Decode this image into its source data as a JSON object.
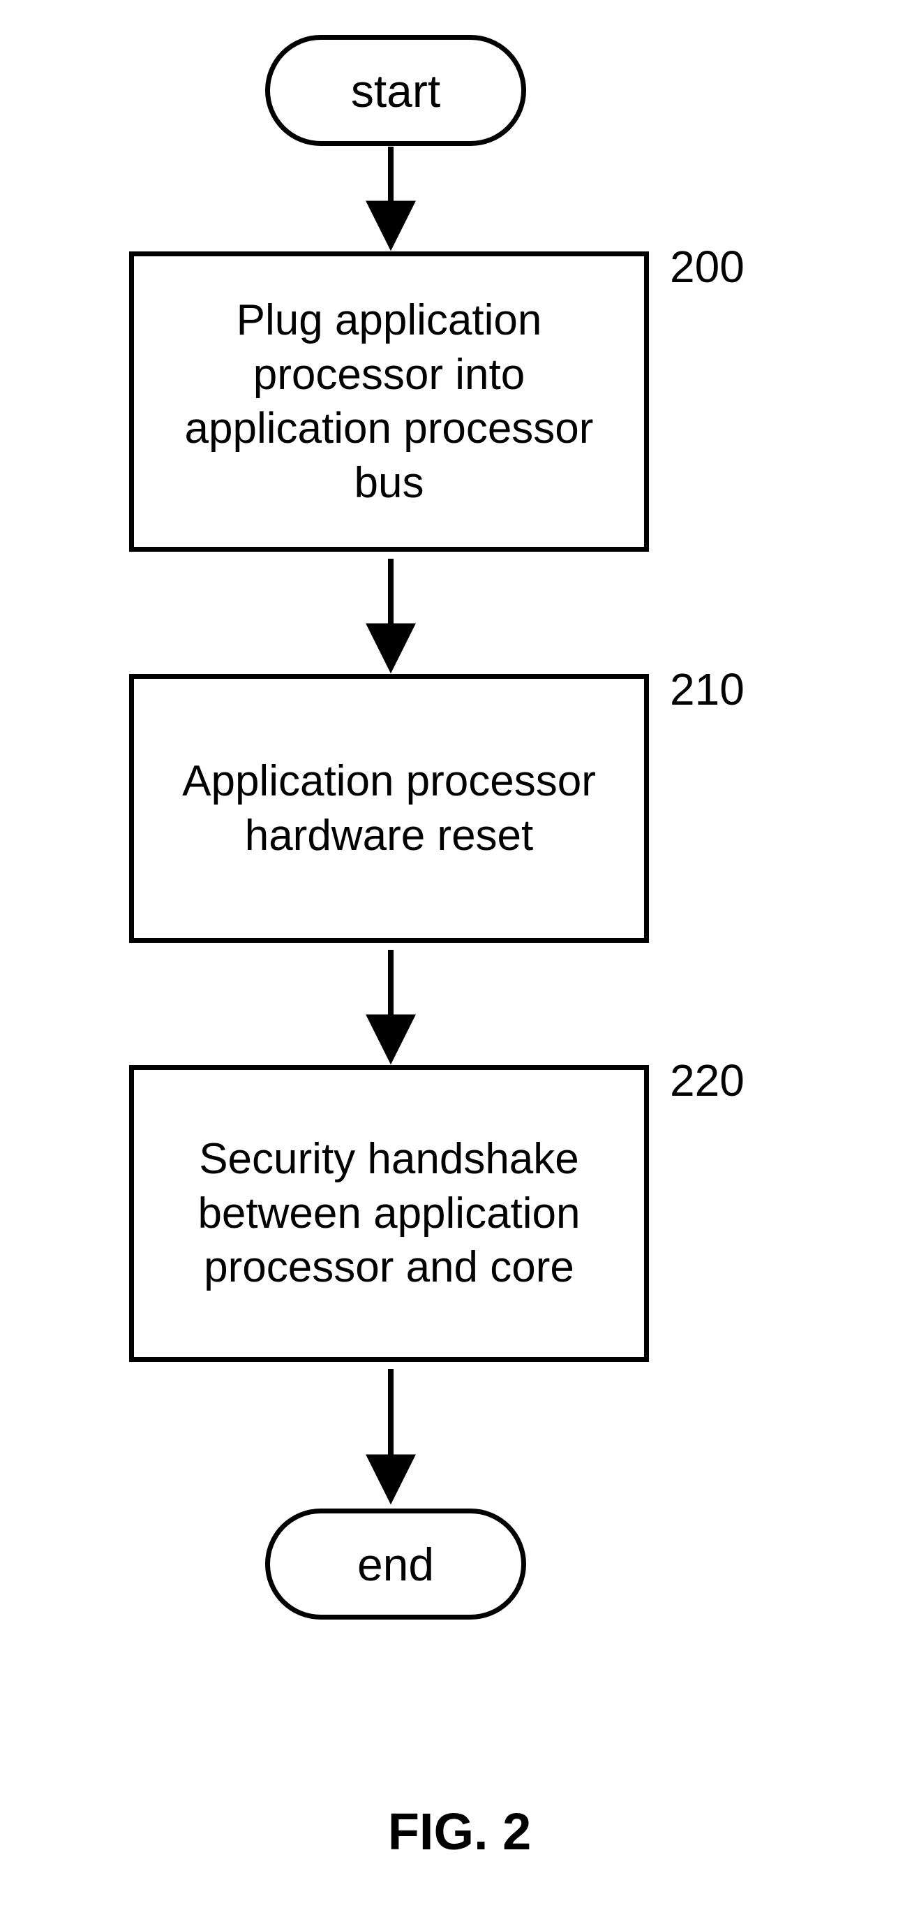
{
  "terminator_start": "start",
  "terminator_end": "end",
  "step0": {
    "text": "Plug application\nprocessor into\napplication processor\nbus",
    "ref": "200"
  },
  "step1": {
    "text": "Application processor\nhardware reset",
    "ref": "210"
  },
  "step2": {
    "text": "Security handshake\nbetween application\nprocessor and core",
    "ref": "220"
  },
  "caption": "FIG. 2"
}
